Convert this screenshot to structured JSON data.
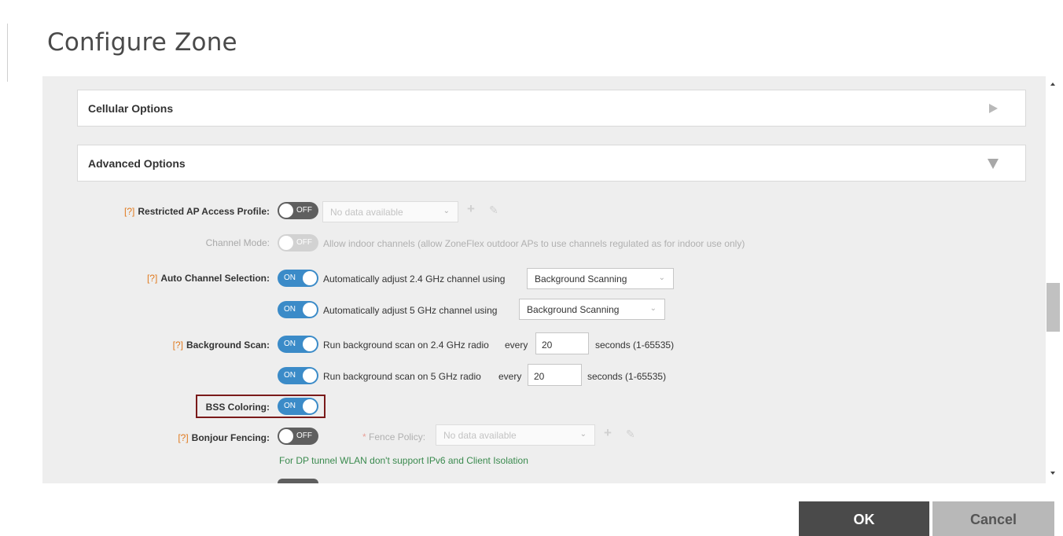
{
  "page": {
    "title": "Configure Zone"
  },
  "sections": {
    "cellular": {
      "title": "Cellular Options",
      "state": "collapsed"
    },
    "advanced": {
      "title": "Advanced Options",
      "state": "expanded"
    }
  },
  "advanced_options": {
    "help_marker": "[?]",
    "restricted_ap": {
      "label": "Restricted AP Access Profile:",
      "toggle": "OFF",
      "select_value": "No data available"
    },
    "channel_mode": {
      "label": "Channel Mode:",
      "toggle": "OFF",
      "description": "Allow indoor channels (allow ZoneFlex outdoor APs to use channels regulated as for indoor use only)"
    },
    "auto_channel": {
      "label": "Auto Channel Selection:",
      "row_24": {
        "toggle": "ON",
        "text": "Automatically adjust 2.4 GHz channel using",
        "select_value": "Background Scanning"
      },
      "row_5": {
        "toggle": "ON",
        "text": "Automatically adjust 5 GHz channel using",
        "select_value": "Background Scanning"
      }
    },
    "background_scan": {
      "label": "Background Scan:",
      "row_24": {
        "toggle": "ON",
        "text": "Run background scan on 2.4 GHz radio",
        "every": "every",
        "value": "20",
        "unit": "seconds (1-65535)"
      },
      "row_5": {
        "toggle": "ON",
        "text": "Run background scan on 5 GHz radio",
        "every": "every",
        "value": "20",
        "unit": "seconds (1-65535)"
      }
    },
    "bss_coloring": {
      "label": "BSS Coloring:",
      "toggle": "ON"
    },
    "bonjour_fencing": {
      "label": "Bonjour Fencing:",
      "toggle": "OFF",
      "fence_policy_required": "*",
      "fence_policy_label": "Fence Policy:",
      "fence_policy_value": "No data available",
      "note": "For DP tunnel WLAN don't support IPv6 and Client Isolation"
    }
  },
  "footer": {
    "ok_label": "OK",
    "cancel_label": "Cancel"
  },
  "colors": {
    "toggle_on": "#3b8bc8",
    "toggle_off": "#5f5f5f",
    "help_marker": "#e07a1f",
    "note_text": "#3a8a4e",
    "highlight_border": "#7a1a1a",
    "ok_button": "#4a4a4a",
    "cancel_button": "#b8b8b8"
  }
}
